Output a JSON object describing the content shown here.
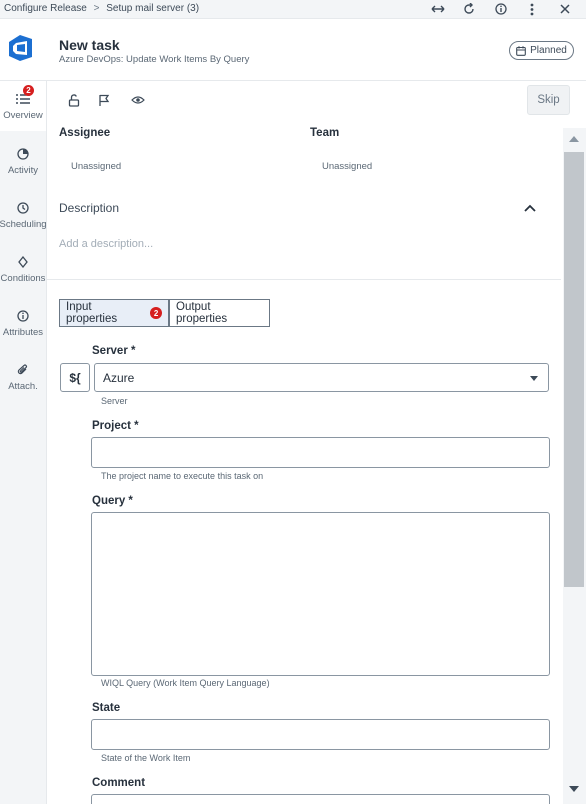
{
  "breadcrumb": {
    "items": [
      "Configure Release",
      "Setup mail server (3)"
    ],
    "separator": ">"
  },
  "window_icons": [
    "resize-icon",
    "refresh-icon",
    "info-icon",
    "more-vert-icon",
    "close-icon"
  ],
  "header": {
    "title": "New task",
    "subtitle": "Azure DevOps: Update Work Items By Query",
    "status": "Planned"
  },
  "nav": {
    "items": [
      {
        "label": "Overview",
        "icon": "list-icon",
        "badge": "2",
        "active": true
      },
      {
        "label": "Activity",
        "icon": "pie-icon"
      },
      {
        "label": "Scheduling",
        "icon": "clock-icon"
      },
      {
        "label": "Conditions",
        "icon": "diamond-icon"
      },
      {
        "label": "Attributes",
        "icon": "info-icon"
      },
      {
        "label": "Attach.",
        "icon": "paperclip-icon"
      }
    ]
  },
  "toolbar": {
    "skip_label": "Skip"
  },
  "assignee": {
    "label": "Assignee",
    "value": "Unassigned"
  },
  "team": {
    "label": "Team",
    "value": "Unassigned"
  },
  "description": {
    "label": "Description",
    "placeholder": "Add a description..."
  },
  "tabs": {
    "input": {
      "label": "Input properties",
      "badge": "2"
    },
    "output": {
      "label": "Output properties"
    }
  },
  "form": {
    "var_button": "${",
    "server": {
      "label": "Server *",
      "value": "Azure",
      "helper": "Server"
    },
    "project": {
      "label": "Project *",
      "value": "",
      "helper": "The project name to execute this task on"
    },
    "query": {
      "label": "Query *",
      "value": "",
      "helper": "WIQL Query (Work Item Query Language)"
    },
    "state": {
      "label": "State",
      "value": "",
      "helper": "State of the Work Item"
    },
    "comment": {
      "label": "Comment"
    }
  },
  "colors": {
    "badge_red": "#d61f1f",
    "accent_blue": "#1c6fd1",
    "active_tab_bg": "#e8eef7"
  }
}
